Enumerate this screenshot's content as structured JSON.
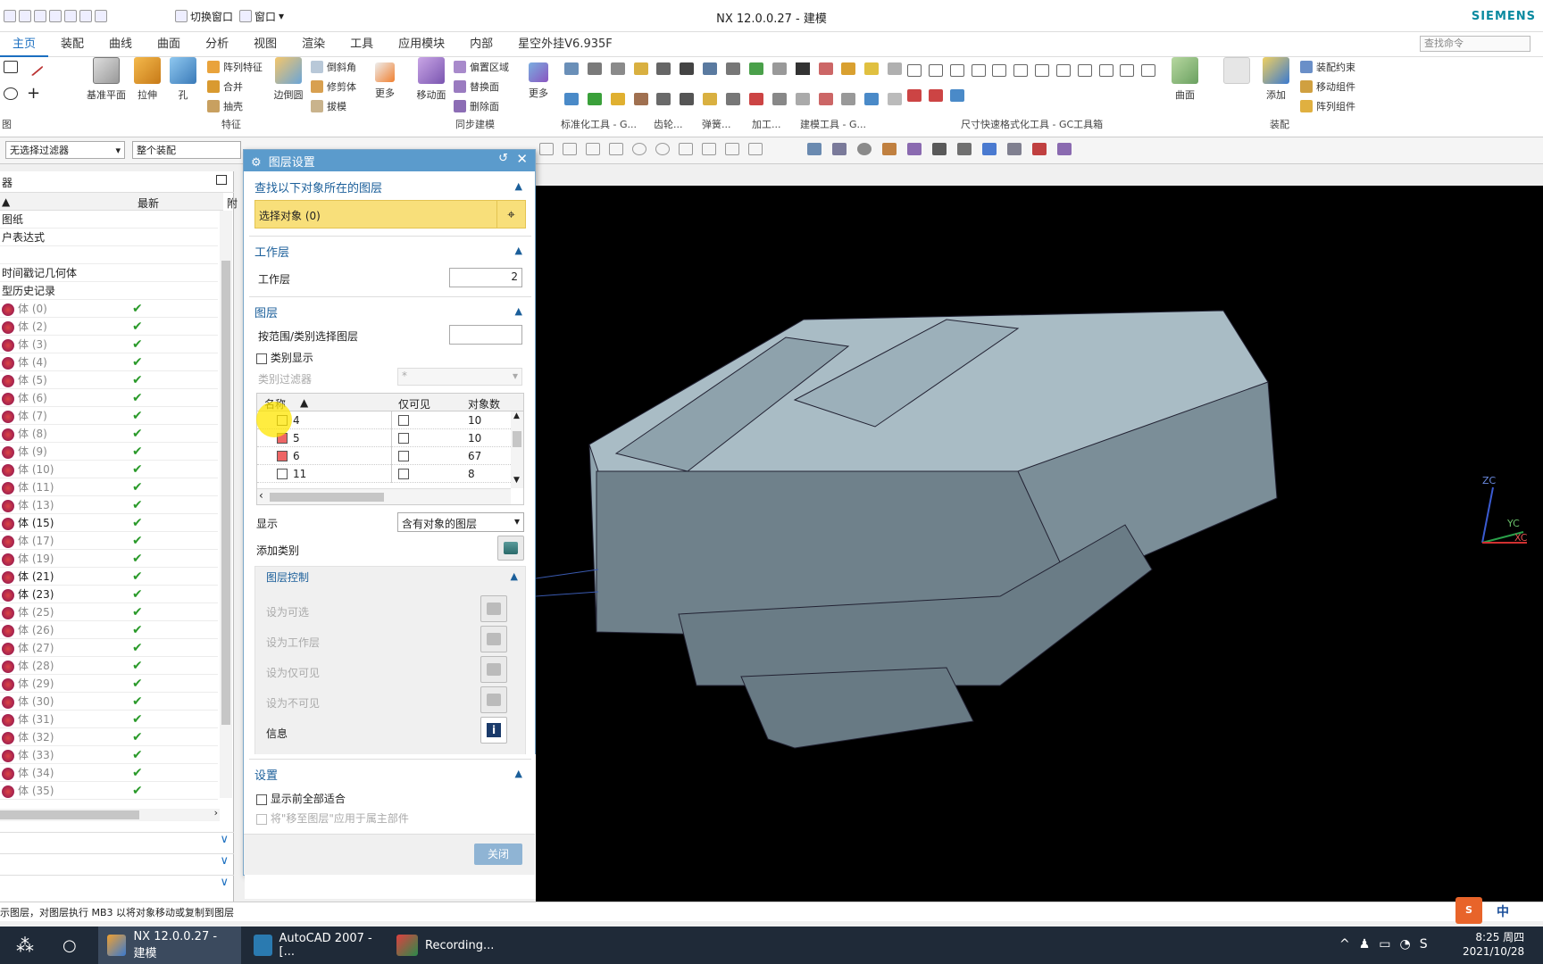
{
  "window": {
    "title": "NX 12.0.0.27 - 建模",
    "brand": "SIEMENS",
    "quick_access": {
      "switch_window": "切换窗口",
      "window_menu": "窗口"
    }
  },
  "menu_tabs": [
    "主页",
    "装配",
    "曲线",
    "曲面",
    "分析",
    "视图",
    "渲染",
    "工具",
    "应用模块",
    "内部",
    "星空外挂V6.935F"
  ],
  "search_placeholder": "查找命令",
  "ribbon": {
    "datum_plane": "基准平面",
    "extrude": "拉伸",
    "hole": "孔",
    "pattern_feature": "阵列特征",
    "unite": "合并",
    "shell": "抽壳",
    "edge_blend": "边倒圆",
    "chamfer": "倒斜角",
    "trim_body": "修剪体",
    "draft": "拔模",
    "more": "更多",
    "move_face": "移动面",
    "offset_region": "偏置区域",
    "replace_face": "替换面",
    "delete_face": "删除面",
    "more2": "更多",
    "surface": "曲面",
    "add": "添加",
    "assembly_constraints": "装配约束",
    "move_component": "移动组件",
    "pattern_component": "阵列组件",
    "group_feature": "特征",
    "group_sync": "同步建模",
    "group_std": "标准化工具 - G...",
    "group_gear": "齿轮...",
    "group_spring": "弹簧...",
    "group_machining": "加工...",
    "group_modeling_tools": "建模工具 - G...",
    "group_dim": "尺寸快速格式化工具 - GC工具箱",
    "group_assembly": "装配",
    "group_direct": "图"
  },
  "selection_bar": {
    "filter": "无选择过滤器",
    "scope": "整个装配"
  },
  "navigator": {
    "col_latest": "最新",
    "col_extra": "附",
    "top_items": [
      "图纸",
      "户表达式",
      "",
      "时间戳记几何体",
      "型历史记录"
    ],
    "bodies": [
      {
        "label": "体 (0)",
        "dark": false
      },
      {
        "label": "体 (2)",
        "dark": false
      },
      {
        "label": "体 (3)",
        "dark": false
      },
      {
        "label": "体 (4)",
        "dark": false
      },
      {
        "label": "体 (5)",
        "dark": false
      },
      {
        "label": "体 (6)",
        "dark": false
      },
      {
        "label": "体 (7)",
        "dark": false
      },
      {
        "label": "体 (8)",
        "dark": false
      },
      {
        "label": "体 (9)",
        "dark": false
      },
      {
        "label": "体 (10)",
        "dark": false
      },
      {
        "label": "体 (11)",
        "dark": false
      },
      {
        "label": "体 (13)",
        "dark": false
      },
      {
        "label": "体 (15)",
        "dark": true
      },
      {
        "label": "体 (17)",
        "dark": false
      },
      {
        "label": "体 (19)",
        "dark": false
      },
      {
        "label": "体 (21)",
        "dark": true
      },
      {
        "label": "体 (23)",
        "dark": true
      },
      {
        "label": "体 (25)",
        "dark": false
      },
      {
        "label": "体 (26)",
        "dark": false
      },
      {
        "label": "体 (27)",
        "dark": false
      },
      {
        "label": "体 (28)",
        "dark": false
      },
      {
        "label": "体 (29)",
        "dark": false
      },
      {
        "label": "体 (30)",
        "dark": false
      },
      {
        "label": "体 (31)",
        "dark": false
      },
      {
        "label": "体 (32)",
        "dark": false
      },
      {
        "label": "体 (33)",
        "dark": false
      },
      {
        "label": "体 (34)",
        "dark": false
      },
      {
        "label": "体 (35)",
        "dark": false
      }
    ],
    "check": "✔"
  },
  "dialog": {
    "title": "图层设置",
    "find_section": "查找以下对象所在的图层",
    "select_object": "选择对象 (0)",
    "work_layer_section": "工作层",
    "work_layer_label": "工作层",
    "work_layer_value": "2",
    "layer_section": "图层",
    "range_label": "按范围/类别选择图层",
    "category_display": "类别显示",
    "category_filter": "类别过滤器",
    "category_filter_value": "*",
    "table_headers": {
      "name": "名称",
      "visible_only": "仅可见",
      "count": "对象数"
    },
    "layers": [
      {
        "name": "4",
        "checked": false,
        "count": "10"
      },
      {
        "name": "5",
        "checked": true,
        "count": "10"
      },
      {
        "name": "6",
        "checked": true,
        "count": "67"
      },
      {
        "name": "11",
        "checked": false,
        "count": "8"
      }
    ],
    "display_label": "显示",
    "display_value": "含有对象的图层",
    "add_category": "添加类别",
    "layer_control": "图层控制",
    "set_selectable": "设为可选",
    "set_work": "设为工作层",
    "set_visible_only": "设为仅可见",
    "set_invisible": "设为不可见",
    "info": "信息",
    "settings_section": "设置",
    "fit_before_display": "显示前全部适合",
    "apply_move_to_owner": "将\"移至图层\"应用于属主部件",
    "close": "关闭"
  },
  "status_bar": "示图层，对图层执行 MB3 以将对象移动或复制到图层",
  "taskbar": {
    "items": [
      "NX 12.0.0.27 - 建模",
      "AutoCAD 2007 - [...",
      "Recording..."
    ],
    "time": "8:25 周四",
    "date": "2021/10/28",
    "ime": "中"
  },
  "colors": {
    "accent": "#1b6fc0",
    "select_highlight": "#f8df7a",
    "dialog_title": "#5b9bcc",
    "viewport_bg": "#000000",
    "model": "#7a8c96"
  },
  "triad": {
    "zc": "ZC",
    "yc": "YC",
    "xc": "XC"
  }
}
